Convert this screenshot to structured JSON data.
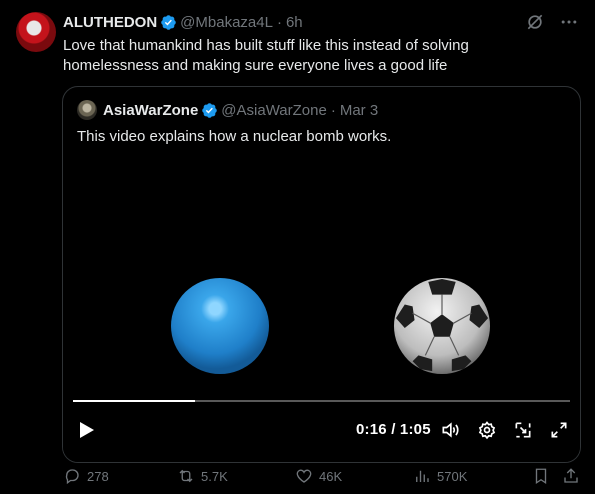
{
  "tweet": {
    "author_name": "ALUTHEDON",
    "handle": "@Mbakaza4L",
    "separator": "·",
    "time": "6h",
    "text": "Love that humankind has built stuff like this instead of solving homelessness and making sure everyone lives a good life"
  },
  "quote": {
    "author_name": "AsiaWarZone",
    "handle": "@AsiaWarZone",
    "separator": "·",
    "date": "Mar 3",
    "text": "This video explains how a nuclear bomb works."
  },
  "video": {
    "time_display": "0:16 / 1:05",
    "progress_fraction": 0.246
  },
  "actions": {
    "replies": "278",
    "reposts": "5.7K",
    "likes": "46K",
    "views": "570K"
  },
  "colors": {
    "verified": "#1d9bf0",
    "muted": "#71767b",
    "text": "#e7e9ea",
    "border": "#2f3336"
  },
  "icons": [
    "grok-icon",
    "more-icon",
    "verified-icon",
    "play-icon",
    "volume-icon",
    "settings-icon",
    "pip-icon",
    "fullscreen-icon",
    "reply-icon",
    "repost-icon",
    "like-icon",
    "views-icon",
    "bookmark-icon",
    "share-icon"
  ]
}
